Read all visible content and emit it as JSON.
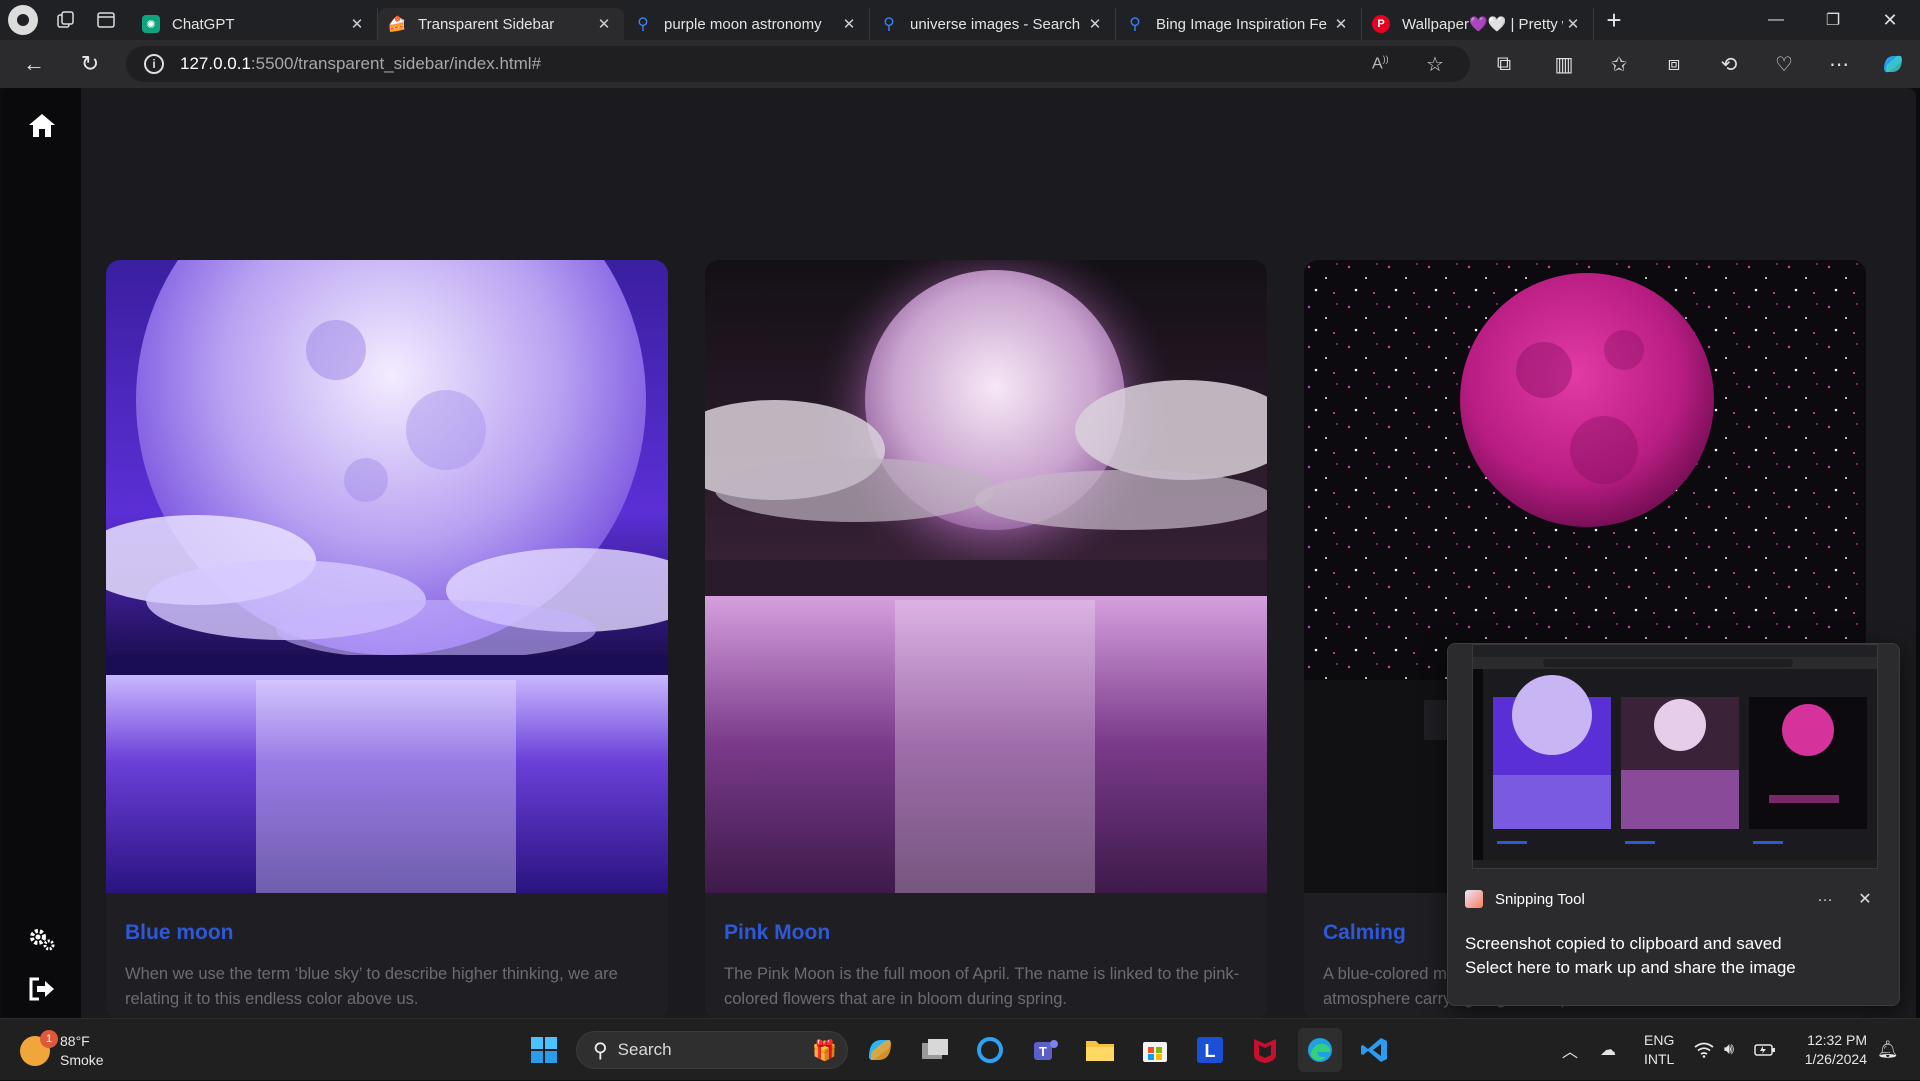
{
  "browser": {
    "tabs": [
      {
        "label": "ChatGPT",
        "fav": "chatgpt-icon",
        "active": false
      },
      {
        "label": "Transparent Sidebar",
        "fav": "cake-icon",
        "active": true
      },
      {
        "label": "purple moon astronomy",
        "fav": "bing-search-icon",
        "active": false
      },
      {
        "label": "universe images - Search",
        "fav": "bing-search-icon",
        "active": false
      },
      {
        "label": "Bing Image Inspiration Fe",
        "fav": "bing-search-icon",
        "active": false
      },
      {
        "label": "Wallpaper💜🤍 | Pretty w",
        "fav": "pinterest-icon",
        "active": false
      }
    ],
    "url": {
      "host": "127.0.0.1",
      "path": ":5500/transparent_sidebar/index.html#"
    }
  },
  "cards": [
    {
      "title": "Blue moon",
      "description": "When we use the term ‘blue sky’ to describe higher thinking, we are relating it to this endless color above us."
    },
    {
      "title": "Pink Moon",
      "description": "The Pink Moon is the full moon of April. The name is linked to the pink-colored flowers that are in bloom during spring."
    },
    {
      "title": "Calming",
      "description": "A blue-colored moon can occur when the moon is viewed through an atmosphere carrying larger dust particles. What"
    }
  ],
  "toast": {
    "app_name": "Snipping Tool",
    "more_label": "···",
    "message_line1": "Screenshot copied to clipboard and saved",
    "message_line2": "Select here to mark up and share the image"
  },
  "taskbar": {
    "weather_temp": "88°F",
    "weather_desc": "Smoke",
    "weather_badge": "1",
    "search_label": "Search",
    "lang_line1": "ENG",
    "lang_line2": "INTL",
    "time": "12:32 PM",
    "date": "1/26/2024"
  },
  "colors": {
    "accent_title": "#2f58d8",
    "sidebar": "#0a0a0c",
    "page_bg": "#1b1b1f"
  }
}
